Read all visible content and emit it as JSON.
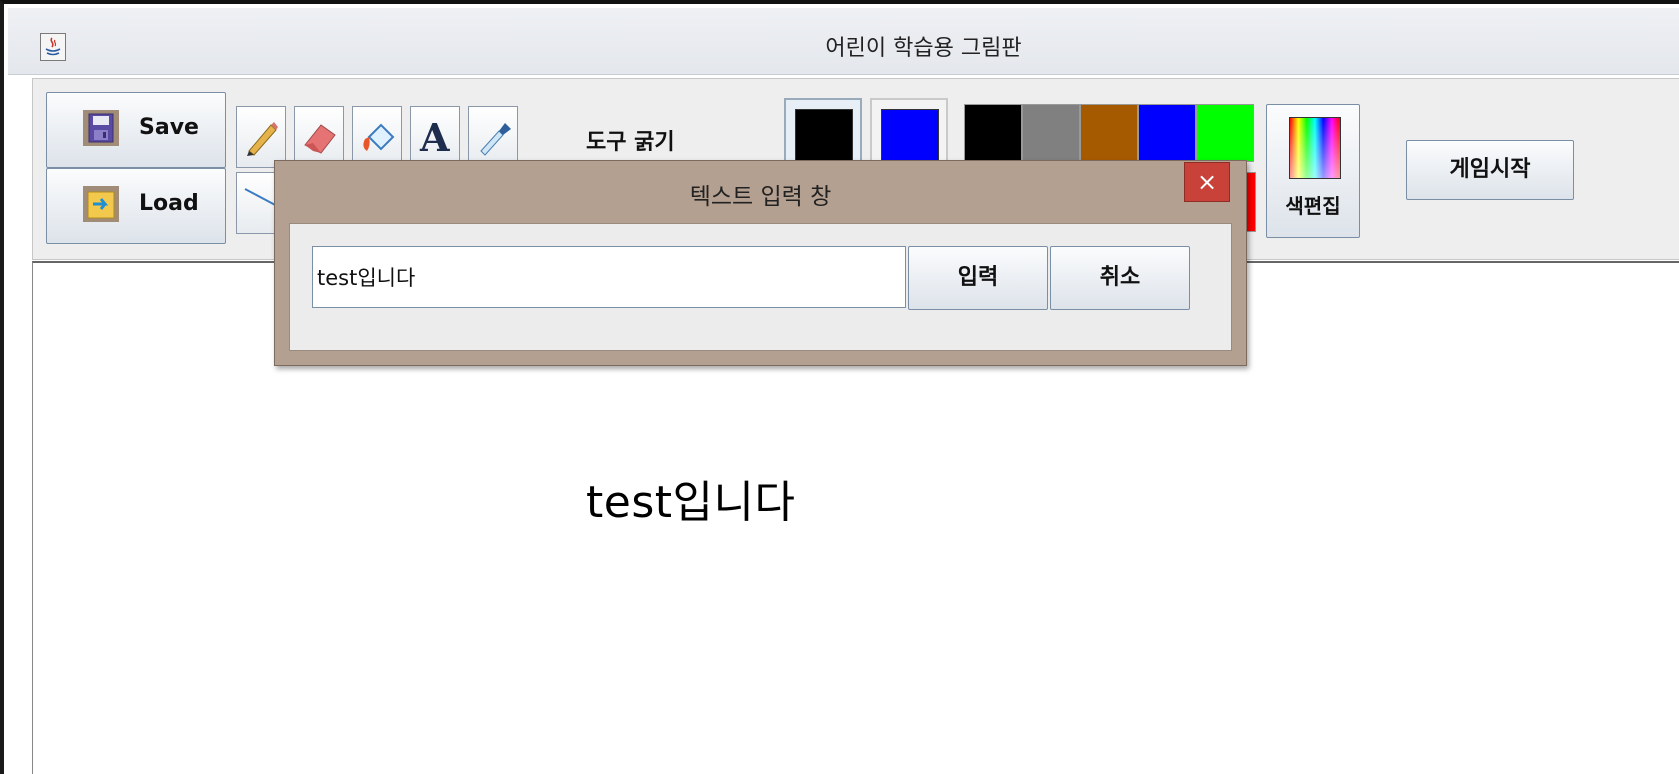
{
  "window": {
    "title": "어린이 학습용 그림판"
  },
  "toolbar": {
    "save_label": "Save",
    "load_label": "Load",
    "thickness_label": "도구 굵기",
    "tools": [
      "pencil-icon",
      "eraser-icon",
      "paint-bucket-icon",
      "text-tool-icon",
      "eyedropper-icon",
      "line-tool-icon"
    ],
    "current_colors": {
      "primary": "#000000",
      "secondary": "#0000ff"
    },
    "palette": [
      "#000000",
      "#808080",
      "#a65a00",
      "#0000ff",
      "#00ff00",
      "#ff0000"
    ],
    "color_edit_label": "색편집",
    "game_start_label": "게임시작"
  },
  "dialog": {
    "title": "텍스트 입력 창",
    "input_value": "test입니다",
    "ok_label": "입력",
    "cancel_label": "취소",
    "close_glyph": "×"
  },
  "canvas": {
    "text": "test입니다"
  }
}
